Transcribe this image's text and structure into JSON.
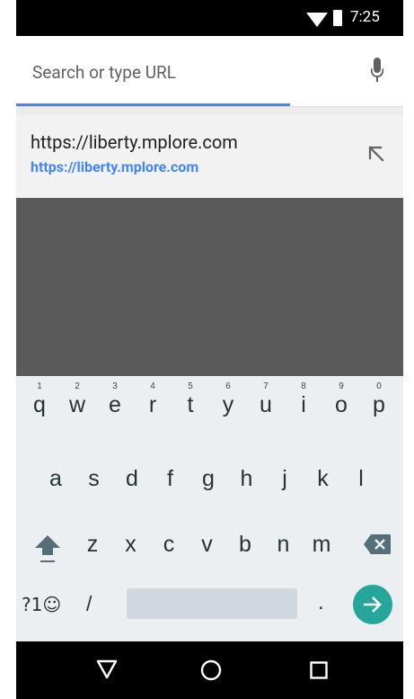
{
  "status": {
    "time": "7:25"
  },
  "search": {
    "placeholder": "Search or type URL",
    "value": ""
  },
  "suggestion": {
    "title": "https://liberty.mplore.com",
    "url": "https://liberty.mplore.com"
  },
  "keyboard": {
    "row1": [
      {
        "ch": "q",
        "hint": "1"
      },
      {
        "ch": "w",
        "hint": "2"
      },
      {
        "ch": "e",
        "hint": "3"
      },
      {
        "ch": "r",
        "hint": "4"
      },
      {
        "ch": "t",
        "hint": "5"
      },
      {
        "ch": "y",
        "hint": "6"
      },
      {
        "ch": "u",
        "hint": "7"
      },
      {
        "ch": "i",
        "hint": "8"
      },
      {
        "ch": "o",
        "hint": "9"
      },
      {
        "ch": "p",
        "hint": "0"
      }
    ],
    "row2": [
      "a",
      "s",
      "d",
      "f",
      "g",
      "h",
      "j",
      "k",
      "l"
    ],
    "row3": [
      "z",
      "x",
      "c",
      "v",
      "b",
      "n",
      "m"
    ],
    "symbols_label": "?1☺",
    "slash_label": "/",
    "period_label": "."
  },
  "colors": {
    "accent": "#4285f4",
    "go_button": "#26a69a",
    "keyboard_bg": "#eceff1",
    "content_dark": "#5a5a5a"
  },
  "icons": {
    "status": [
      "wifi-icon",
      "battery-icon"
    ],
    "urlbar": [
      "mic-icon"
    ],
    "suggestion": [
      "refine-arrow-icon"
    ],
    "keyboard": [
      "shift-icon",
      "backspace-icon",
      "go-arrow-icon"
    ],
    "nav": [
      "back-triangle-icon",
      "home-circle-icon",
      "recents-square-icon"
    ]
  }
}
